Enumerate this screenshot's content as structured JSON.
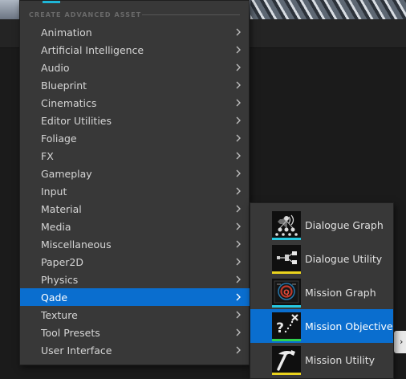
{
  "menu": {
    "header": "CREATE ADVANCED ASSET",
    "accent_color": "#1fb6d8",
    "items": [
      {
        "label": "Animation"
      },
      {
        "label": "Artificial Intelligence"
      },
      {
        "label": "Audio"
      },
      {
        "label": "Blueprint"
      },
      {
        "label": "Cinematics"
      },
      {
        "label": "Editor Utilities"
      },
      {
        "label": "Foliage"
      },
      {
        "label": "FX"
      },
      {
        "label": "Gameplay"
      },
      {
        "label": "Input"
      },
      {
        "label": "Material"
      },
      {
        "label": "Media"
      },
      {
        "label": "Miscellaneous"
      },
      {
        "label": "Paper2D"
      },
      {
        "label": "Physics"
      },
      {
        "label": "Qade",
        "active": true
      },
      {
        "label": "Texture"
      },
      {
        "label": "Tool Presets"
      },
      {
        "label": "User Interface"
      }
    ]
  },
  "submenu": {
    "items": [
      {
        "label": "Dialogue Graph",
        "icon": "dialogue-graph-icon",
        "accent": "#27c9e0"
      },
      {
        "label": "Dialogue Utility",
        "icon": "dialogue-utility-icon",
        "accent": "#e9d21e"
      },
      {
        "label": "Mission Graph",
        "icon": "mission-graph-icon",
        "accent": "#27c9e0"
      },
      {
        "label": "Mission Objective",
        "icon": "mission-objective-icon",
        "accent": "#2fd14f",
        "active": true
      },
      {
        "label": "Mission Utility",
        "icon": "mission-utility-icon",
        "accent": "#e9d21e"
      }
    ]
  },
  "colors": {
    "highlight": "#0a6ecf",
    "menu_bg": "#383838"
  }
}
